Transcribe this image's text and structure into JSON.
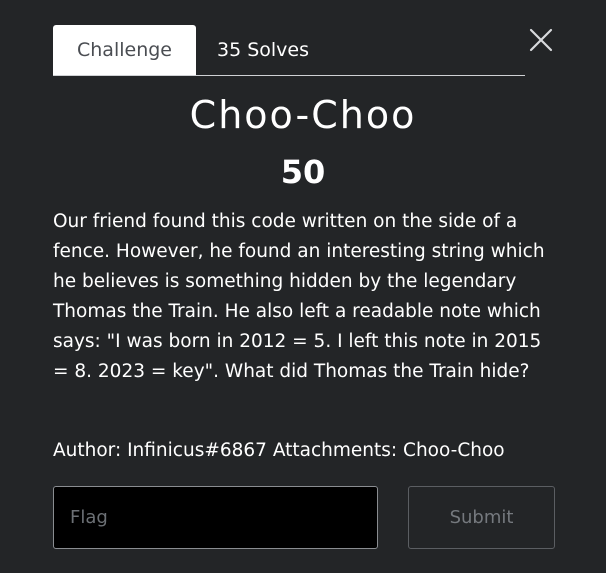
{
  "tabs": [
    {
      "label": "Challenge",
      "active": true
    },
    {
      "label": "35 Solves",
      "active": false
    }
  ],
  "challenge": {
    "title": "Choo-Choo",
    "points": "50",
    "description": "Our friend found this code written on the side of a fence. However, he found an interesting string which he believes is something hidden by the legendary Thomas the Train. He also left a readable note which says: \"I was born in 2012 = 5. I left this note in 2015 = 8. 2023 = key\". What did Thomas the Train hide?",
    "meta": {
      "author_label": "Author:",
      "author": "Infinicus#6867",
      "attachments_label": "Attachments:",
      "attachment": "Choo-Choo"
    }
  },
  "form": {
    "flag_placeholder": "Flag",
    "flag_value": "",
    "submit_label": "Submit"
  },
  "icons": {
    "close": "close-icon"
  },
  "colors": {
    "background": "#232527",
    "text": "#ffffff",
    "active_tab_bg": "#ffffff",
    "active_tab_text": "#4a4d52",
    "input_bg": "#000000",
    "disabled_text": "#75797e"
  }
}
